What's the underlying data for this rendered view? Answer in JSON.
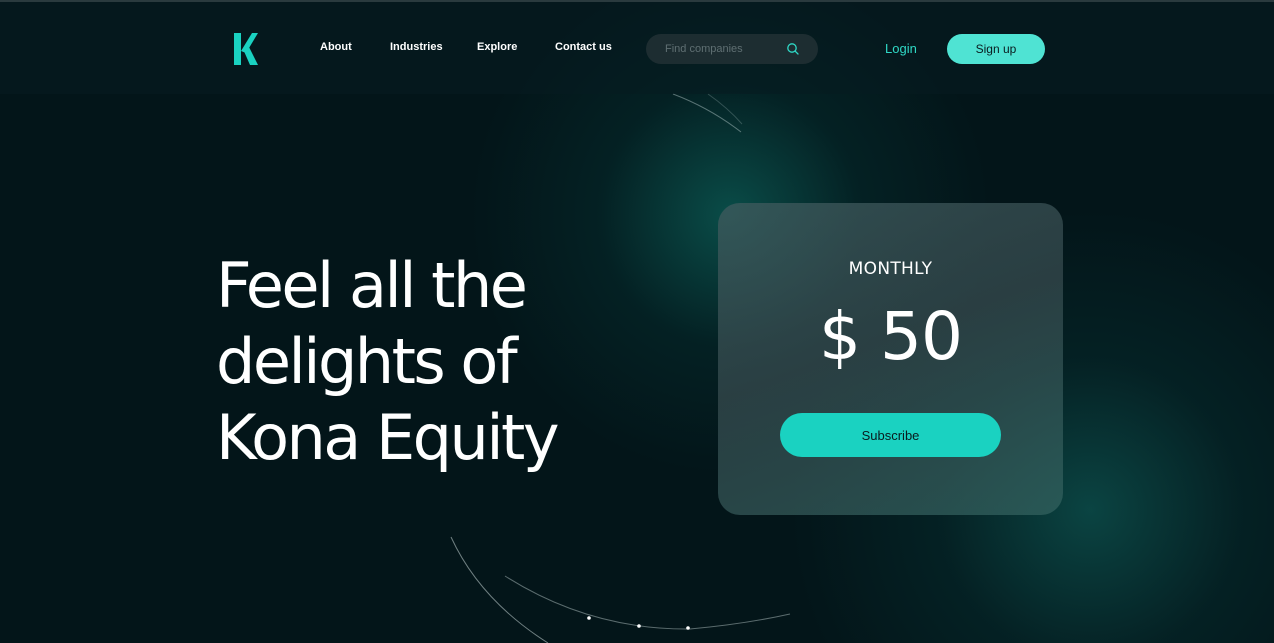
{
  "colors": {
    "background": "#031519",
    "accent": "#1ad2c1",
    "accent_light": "#4fe3d3",
    "login_text": "#2fd9c6",
    "card_bg": "#3a5558"
  },
  "header": {
    "logo_icon": "kona-k-logo",
    "nav": {
      "about": "About",
      "industries": "Industries",
      "explore": "Explore",
      "contact": "Contact us"
    },
    "search": {
      "placeholder": "Find companies",
      "value": "",
      "icon": "search-icon"
    },
    "login_label": "Login",
    "signup_label": "Sign up"
  },
  "hero": {
    "title_line1": "Feel all the",
    "title_line2": "delights of",
    "title_line3": "Kona Equity"
  },
  "pricing": {
    "period": "MONTHLY",
    "price": "$ 50",
    "subscribe_label": "Subscribe"
  }
}
